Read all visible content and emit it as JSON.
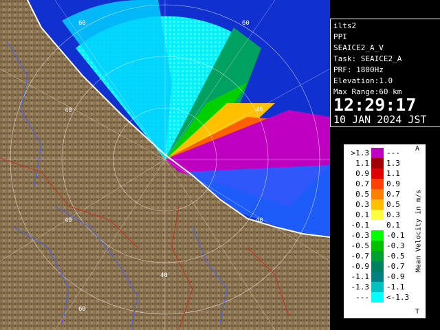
{
  "info": {
    "site": "ilts2",
    "product": "PPI",
    "scan": "SEAICE2_A_V",
    "task": "Task: SEAICE2_A",
    "prf": "PRF: 1800Hz",
    "elevation": "Elevation:1.0",
    "max_range": "Max Range:60 km",
    "time": "12:29:17",
    "date": "10 JAN 2024 JST"
  },
  "range_ring_labels": [
    "60",
    "40",
    "40",
    "40",
    "40",
    "40",
    "60",
    "60"
  ],
  "legend": {
    "title": "Mean Velocity in m/s",
    "top_marker": "A",
    "bottom_marker": "T",
    "rows": [
      {
        "left": ">1.3",
        "right": "---",
        "color": "#c000c0"
      },
      {
        "left": "1.1",
        "right": "1.3",
        "color": "#a00000"
      },
      {
        "left": "0.9",
        "right": "1.1",
        "color": "#e00000"
      },
      {
        "left": "0.7",
        "right": "0.9",
        "color": "#ff4000"
      },
      {
        "left": "0.5",
        "right": "0.7",
        "color": "#ff8000"
      },
      {
        "left": "0.3",
        "right": "0.5",
        "color": "#ffc000"
      },
      {
        "left": "0.1",
        "right": "0.3",
        "color": "#ffff40"
      },
      {
        "left": "-0.1",
        "right": "0.1",
        "color": "#ffffff"
      },
      {
        "left": "-0.3",
        "right": "-0.1",
        "color": "#00ff00"
      },
      {
        "left": "-0.5",
        "right": "-0.3",
        "color": "#00c000"
      },
      {
        "left": "-0.7",
        "right": "-0.5",
        "color": "#00a030"
      },
      {
        "left": "-0.9",
        "right": "-0.7",
        "color": "#008060"
      },
      {
        "left": "-1.1",
        "right": "-0.9",
        "color": "#008080"
      },
      {
        "left": "-1.3",
        "right": "-1.1",
        "color": "#00c0c0"
      },
      {
        "left": "---",
        "right": "<-1.3",
        "color": "#00ffff"
      }
    ]
  },
  "colors": {
    "land": "#8a7350",
    "sea_blue": "#2060ff",
    "outbound_max": "#c000c0"
  }
}
